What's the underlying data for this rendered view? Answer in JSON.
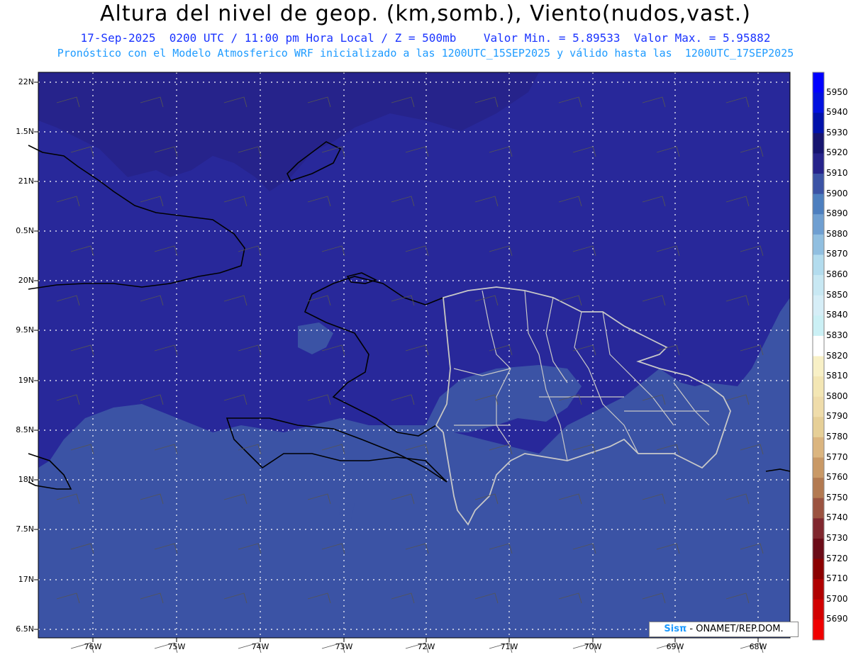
{
  "header": {
    "title": "Altura del nivel de geop. (km,somb.), Viento(nudos,vast.)",
    "subtitle_1": "17-Sep-2025  0200 UTC / 11:00 pm Hora Local / Z = 500mb    Valor Min. = 5.89533  Valor Max. = 5.95882",
    "subtitle_2": "Pronóstico con el Modelo Atmosferico WRF inicializado a las 1200UTC_15SEP2025 y válido hasta las  1200UTC_17SEP2025"
  },
  "map": {
    "lat_labels": [
      "22N",
      "1.5N",
      "21N",
      "0.5N",
      "20N",
      "9.5N",
      "19N",
      "8.5N",
      "18N",
      "7.5N",
      "17N",
      "6.5N"
    ],
    "lon_labels": [
      "76W",
      "75W",
      "74W",
      "73W",
      "72W",
      "71W",
      "70W",
      "69W",
      "68W"
    ],
    "colors": {
      "band_5920": "#26238b",
      "band_5910": "#28289a",
      "band_5900": "#3b53a5",
      "gridline": "#ffffff",
      "coastline": "#000000",
      "province_border": "#c8c8c8"
    }
  },
  "colorbar": {
    "levels": [
      "5950",
      "5940",
      "5930",
      "5920",
      "5910",
      "5900",
      "5890",
      "5880",
      "5870",
      "5860",
      "5850",
      "5840",
      "5830",
      "5820",
      "5810",
      "5800",
      "5790",
      "5780",
      "5770",
      "5760",
      "5750",
      "5740",
      "5730",
      "5720",
      "5710",
      "5700",
      "5690"
    ],
    "colors": [
      "#0000ff",
      "#0010df",
      "#0011aa",
      "#16146f",
      "#26238b",
      "#3b53a5",
      "#4d7fbf",
      "#6f9fd1",
      "#91bfe0",
      "#b3dcee",
      "#c8e8f3",
      "#d6eef7",
      "#cbf0f5",
      "#ffffff",
      "#f8f0c6",
      "#f3e6b4",
      "#efdcaa",
      "#e6cf97",
      "#dbb57f",
      "#c99966",
      "#b37a51",
      "#9b5340",
      "#80272e",
      "#6b0b17",
      "#8b0000",
      "#b00000",
      "#d20000",
      "#f00000"
    ]
  },
  "credit": {
    "logo": "Sisπ",
    "text": " - ONAMET/REP.DOM."
  }
}
